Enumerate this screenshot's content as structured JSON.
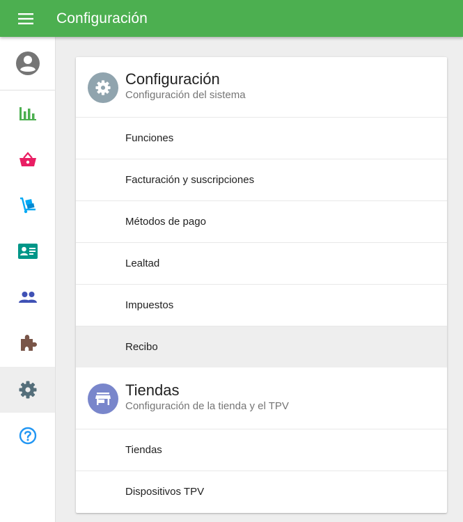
{
  "header": {
    "title": "Configuración",
    "color": "#4caf50"
  },
  "sidebar": {
    "items": [
      {
        "icon": "account-circle-icon",
        "color": "#757575"
      },
      {
        "icon": "bar-chart-icon",
        "color": "#4caf50"
      },
      {
        "icon": "shopping-basket-icon",
        "color": "#e91e63"
      },
      {
        "icon": "dolly-cart-icon",
        "color": "#03a9f4"
      },
      {
        "icon": "contact-card-icon",
        "color": "#009688"
      },
      {
        "icon": "people-icon",
        "color": "#3f51b5"
      },
      {
        "icon": "puzzle-piece-icon",
        "color": "#795548"
      },
      {
        "icon": "gear-icon",
        "color": "#546e7a",
        "active": true
      },
      {
        "icon": "help-circle-icon",
        "color": "#2196f3"
      }
    ]
  },
  "sections": [
    {
      "title": "Configuración",
      "subtitle": "Configuración del sistema",
      "icon": "gear-icon",
      "icon_bg": "#90a4ae",
      "items": [
        {
          "label": "Funciones"
        },
        {
          "label": "Facturación y suscripciones"
        },
        {
          "label": "Métodos de pago"
        },
        {
          "label": "Lealtad"
        },
        {
          "label": "Impuestos"
        },
        {
          "label": "Recibo",
          "active": true
        }
      ]
    },
    {
      "title": "Tiendas",
      "subtitle": "Configuración de la tienda y el TPV",
      "icon": "store-icon",
      "icon_bg": "#7986cb",
      "items": [
        {
          "label": "Tiendas"
        },
        {
          "label": "Dispositivos TPV"
        }
      ]
    }
  ]
}
